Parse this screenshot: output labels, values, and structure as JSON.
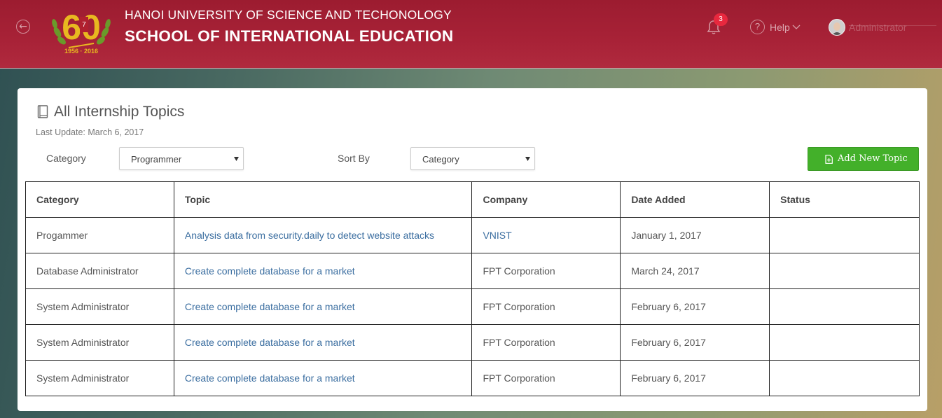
{
  "header": {
    "university": "HANOI UNIVERSITY OF SCIENCE AND TECHONOLOGY",
    "school": "SCHOOL OF INTERNATIONAL EDUCATION",
    "logo_text": "60",
    "logo_years": "1956 · 2016",
    "notifications_count": "3",
    "help_label": "Help",
    "user_name": "Administrator"
  },
  "page": {
    "title": "All Internship Topics",
    "last_update": "Last Update: March 6, 2017"
  },
  "filters": {
    "category_label": "Category",
    "category_value": "Programmer",
    "sort_label": "Sort By",
    "sort_value": "Category"
  },
  "actions": {
    "add_label": "Add New Topic"
  },
  "table": {
    "headers": [
      "Category",
      "Topic",
      "Company",
      "Date Added",
      "Status"
    ],
    "rows": [
      {
        "category": "Progammer",
        "topic": "Analysis data from security.daily to detect website attacks",
        "company": "VNIST",
        "date": "January 1, 2017",
        "status": ""
      },
      {
        "category": "Database Administrator",
        "topic": "Create complete database for a market",
        "company": "FPT Corporation",
        "date": "March 24, 2017",
        "status": ""
      },
      {
        "category": "System Administrator",
        "topic": "Create complete database for a market",
        "company": "FPT Corporation",
        "date": "February 6, 2017",
        "status": ""
      },
      {
        "category": "System Administrator",
        "topic": "Create complete database for a market",
        "company": "FPT Corporation",
        "date": "February 6, 2017",
        "status": ""
      },
      {
        "category": "System Administrator",
        "topic": "Create complete database for a market",
        "company": "FPT Corporation",
        "date": "February 6, 2017",
        "status": ""
      }
    ]
  },
  "colors": {
    "header_red": "#a82237",
    "link_blue": "#3b6ea0",
    "button_green": "#43b02a",
    "badge_red": "#e8283e"
  }
}
